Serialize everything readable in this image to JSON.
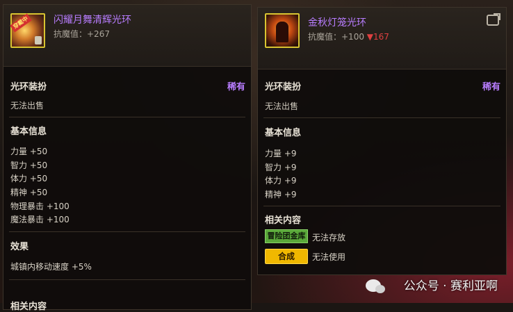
{
  "left_panel": {
    "badge": "穿戴中",
    "item_name": "闪耀月舞清辉光环",
    "stat": "抗魔值：+267",
    "category": "光环装扮",
    "rarity": "稀有",
    "sell_note": "无法出售",
    "basic_info_title": "基本信息",
    "attributes": [
      "力量 +50",
      "智力 +50",
      "体力 +50",
      "精神 +50",
      "物理暴击 +100",
      "魔法暴击 +100"
    ],
    "effect_title": "效果",
    "effect_text": "城镇内移动速度 +5%",
    "next_section_cut": "相关内容"
  },
  "right_panel": {
    "item_name": "金秋灯笼光环",
    "stat_prefix": "抗魔值：+100",
    "stat_diff": "▼167",
    "category": "光环装扮",
    "rarity": "稀有",
    "sell_note": "无法出售",
    "basic_info_title": "基本信息",
    "attributes": [
      "力量 +9",
      "智力 +9",
      "体力 +9",
      "精神 +9"
    ],
    "related_title": "相关内容",
    "related": [
      {
        "button": "冒险团金库",
        "note": "无法存放"
      },
      {
        "button": "合成",
        "note": "无法使用"
      }
    ]
  },
  "watermark": "公众号 · 赛利亚啊",
  "colors": {
    "rarity_purple": "#b87dff",
    "downgrade_red": "#e04040",
    "button_green": "#5aa83a",
    "button_yellow": "#f0b800"
  }
}
